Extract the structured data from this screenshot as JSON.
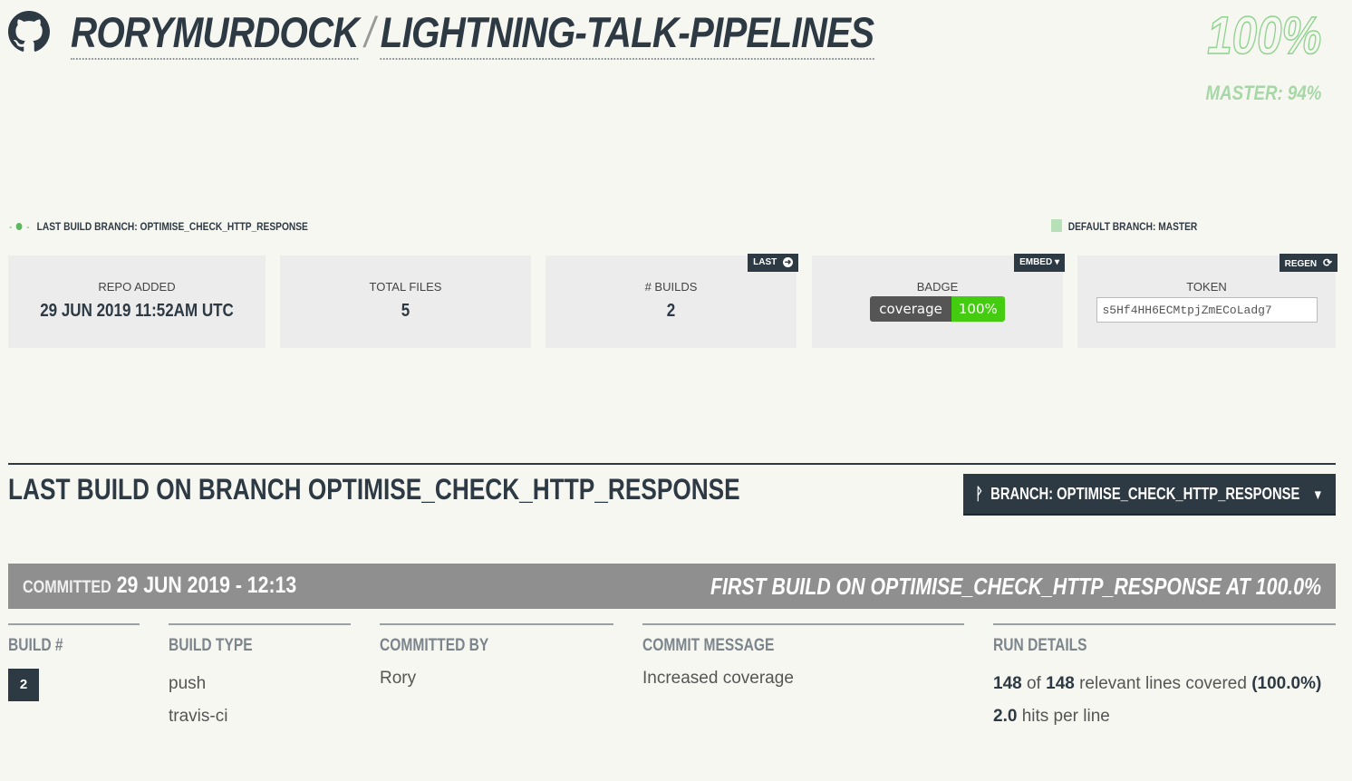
{
  "header": {
    "owner": "RORYMURDOCK",
    "separator": "/",
    "repo": "LIGHTNING-TALK-PIPELINES",
    "coverage": "100%",
    "master_coverage": "MASTER: 94%",
    "icon": "github-icon"
  },
  "legend": {
    "last_build": "LAST BUILD BRANCH: OPTIMISE_CHECK_HTTP_RESPONSE",
    "default_branch": "DEFAULT BRANCH: MASTER",
    "colors": {
      "last_build": "#5cb85c",
      "default_branch": "#b8e0b8"
    }
  },
  "stats": {
    "repo_added": {
      "label": "REPO ADDED",
      "value": "29 JUN 2019 11:52AM UTC"
    },
    "total_files": {
      "label": "TOTAL FILES",
      "value": "5"
    },
    "builds": {
      "label": "# BUILDS",
      "value": "2",
      "tag": "LAST"
    },
    "badge": {
      "label": "BADGE",
      "tag": "EMBED ▾",
      "left": "coverage",
      "right": "100%"
    },
    "token": {
      "label": "TOKEN",
      "tag": "REGEN",
      "value": "s5Hf4HH6ECMtpjZmECoLadg7"
    }
  },
  "section": {
    "title": "LAST BUILD ON BRANCH OPTIMISE_CHECK_HTTP_RESPONSE",
    "branch_button": "BRANCH: OPTIMISE_CHECK_HTTP_RESPONSE",
    "branch_caret": "▼"
  },
  "commit_bar": {
    "committed_label": "COMMITTED",
    "committed_date": "29 JUN 2019 - 12:13",
    "summary": "FIRST BUILD ON OPTIMISE_CHECK_HTTP_RESPONSE AT 100.0%"
  },
  "columns": {
    "build": {
      "head": "BUILD #",
      "value": "2"
    },
    "type": {
      "head": "BUILD TYPE",
      "values": [
        "push",
        "travis-ci"
      ]
    },
    "committer": {
      "head": "COMMITTED BY",
      "value": "Rory"
    },
    "message": {
      "head": "COMMIT MESSAGE",
      "value": "Increased coverage"
    },
    "run": {
      "head": "RUN DETAILS",
      "covered": "148",
      "of": "of",
      "relevant": "148",
      "relevant_text": "relevant lines covered",
      "pct": "(100.0%)",
      "hits": "2.0",
      "hits_text": "hits per line"
    }
  },
  "colors": {
    "primary": "#2d3a44",
    "accent_green": "#8ed28e",
    "bar_gray": "#8f8f8f",
    "background": "#f7f7f2"
  }
}
